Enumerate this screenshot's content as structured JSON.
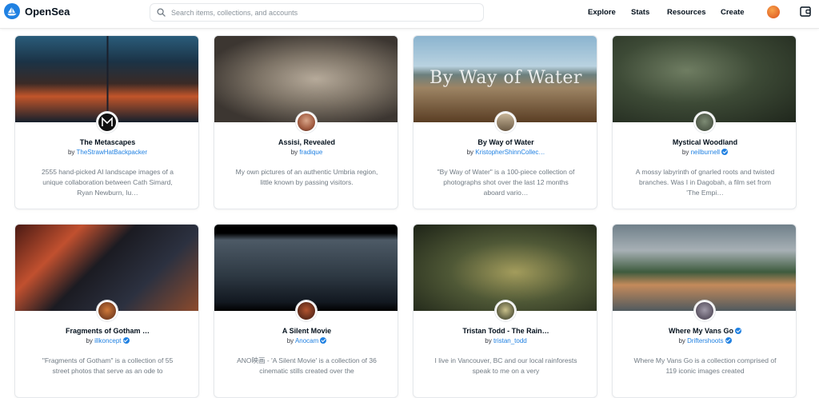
{
  "nav": {
    "brand": "OpenSea",
    "search_placeholder": "Search items, collections, and accounts",
    "links": [
      "Explore",
      "Stats",
      "Resources",
      "Create"
    ],
    "brand_color": "#2081e2"
  },
  "collections": [
    {
      "title": "The Metascapes",
      "by": "by",
      "user": "TheStrawHatBackpacker",
      "verified": false,
      "description": "2555 hand-picked AI landscape images of a unique collaboration between Cath Simard, Ryan Newburn, Iu…"
    },
    {
      "title": "Assisi, Revealed",
      "by": "by",
      "user": "fradique",
      "verified": false,
      "description": "My own pictures of an authentic Umbria region, little known by passing visitors."
    },
    {
      "title": "By Way of Water",
      "by": "by",
      "user": "KristopherShinnCollec…",
      "verified": false,
      "banner_text": "By Way of Water",
      "description": "\"By Way of Water\" is a 100-piece collection of photographs shot over the last 12 months aboard vario…"
    },
    {
      "title": "Mystical Woodland",
      "by": "by",
      "user": "neilburnell",
      "verified": true,
      "description": "A mossy labyrinth of gnarled roots and twisted branches. Was I in Dagobah, a film set from 'The Empi…"
    },
    {
      "title": "Fragments of Gotham …",
      "by": "by",
      "user": "illkoncept",
      "verified": true,
      "description": "\"Fragments of Gotham\" is a collection of 55 street photos that serve as an ode to"
    },
    {
      "title": "A Silent Movie",
      "by": "by",
      "user": "Anocam",
      "verified": true,
      "description": "ANO映画 - 'A Silent Movie' is a collection of 36 cinematic stills created over the"
    },
    {
      "title": "Tristan Todd - The Rain…",
      "by": "by",
      "user": "tristan_todd",
      "verified": false,
      "description": "I live in Vancouver, BC and our local rainforests speak to me on a very"
    },
    {
      "title": "Where My Vans Go",
      "by": "by",
      "user": "Driftershoots",
      "verified": true,
      "title_verified": true,
      "description": "Where My Vans Go is a collection comprised of 119 iconic images created"
    }
  ]
}
